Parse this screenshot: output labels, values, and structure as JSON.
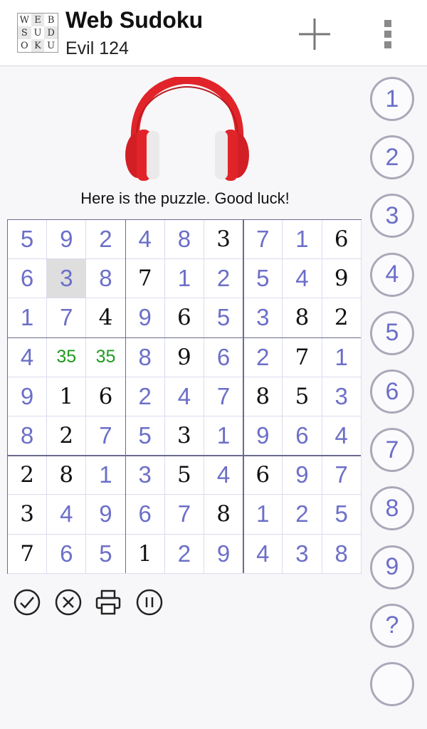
{
  "header": {
    "logo_letters": [
      "W",
      "E",
      "B",
      "S",
      "U",
      "D",
      "O",
      "K",
      "U"
    ],
    "title": "Web Sudoku",
    "subtitle": "Evil 124",
    "new_icon": "plus-icon",
    "menu_icon": "overflow-menu-icon"
  },
  "message": "Here is the puzzle. Good luck!",
  "colors": {
    "given": "#111111",
    "filled": "#6c6fc8",
    "notes": "#1f9a1f",
    "selected_bg": "#dedede",
    "headphones_red": "#e0242a"
  },
  "grid": {
    "rows": [
      [
        {
          "v": "5",
          "t": "filled"
        },
        {
          "v": "9",
          "t": "filled"
        },
        {
          "v": "2",
          "t": "filled"
        },
        {
          "v": "4",
          "t": "filled"
        },
        {
          "v": "8",
          "t": "filled"
        },
        {
          "v": "3",
          "t": "given"
        },
        {
          "v": "7",
          "t": "filled"
        },
        {
          "v": "1",
          "t": "filled"
        },
        {
          "v": "6",
          "t": "given"
        }
      ],
      [
        {
          "v": "6",
          "t": "filled"
        },
        {
          "v": "3",
          "t": "filled",
          "selected": true
        },
        {
          "v": "8",
          "t": "filled"
        },
        {
          "v": "7",
          "t": "given"
        },
        {
          "v": "1",
          "t": "filled"
        },
        {
          "v": "2",
          "t": "filled"
        },
        {
          "v": "5",
          "t": "filled"
        },
        {
          "v": "4",
          "t": "filled"
        },
        {
          "v": "9",
          "t": "given"
        }
      ],
      [
        {
          "v": "1",
          "t": "filled"
        },
        {
          "v": "7",
          "t": "filled"
        },
        {
          "v": "4",
          "t": "given"
        },
        {
          "v": "9",
          "t": "filled"
        },
        {
          "v": "6",
          "t": "given"
        },
        {
          "v": "5",
          "t": "filled"
        },
        {
          "v": "3",
          "t": "filled"
        },
        {
          "v": "8",
          "t": "given"
        },
        {
          "v": "2",
          "t": "given"
        }
      ],
      [
        {
          "v": "4",
          "t": "filled"
        },
        {
          "v": "35",
          "t": "notes"
        },
        {
          "v": "35",
          "t": "notes"
        },
        {
          "v": "8",
          "t": "filled"
        },
        {
          "v": "9",
          "t": "given"
        },
        {
          "v": "6",
          "t": "filled"
        },
        {
          "v": "2",
          "t": "filled"
        },
        {
          "v": "7",
          "t": "given"
        },
        {
          "v": "1",
          "t": "filled"
        }
      ],
      [
        {
          "v": "9",
          "t": "filled"
        },
        {
          "v": "1",
          "t": "given"
        },
        {
          "v": "6",
          "t": "given"
        },
        {
          "v": "2",
          "t": "filled"
        },
        {
          "v": "4",
          "t": "filled"
        },
        {
          "v": "7",
          "t": "filled"
        },
        {
          "v": "8",
          "t": "given"
        },
        {
          "v": "5",
          "t": "given"
        },
        {
          "v": "3",
          "t": "filled"
        }
      ],
      [
        {
          "v": "8",
          "t": "filled"
        },
        {
          "v": "2",
          "t": "given"
        },
        {
          "v": "7",
          "t": "filled"
        },
        {
          "v": "5",
          "t": "filled"
        },
        {
          "v": "3",
          "t": "given"
        },
        {
          "v": "1",
          "t": "filled"
        },
        {
          "v": "9",
          "t": "filled"
        },
        {
          "v": "6",
          "t": "filled"
        },
        {
          "v": "4",
          "t": "filled"
        }
      ],
      [
        {
          "v": "2",
          "t": "given"
        },
        {
          "v": "8",
          "t": "given"
        },
        {
          "v": "1",
          "t": "filled"
        },
        {
          "v": "3",
          "t": "filled"
        },
        {
          "v": "5",
          "t": "given"
        },
        {
          "v": "4",
          "t": "filled"
        },
        {
          "v": "6",
          "t": "given"
        },
        {
          "v": "9",
          "t": "filled"
        },
        {
          "v": "7",
          "t": "filled"
        }
      ],
      [
        {
          "v": "3",
          "t": "given"
        },
        {
          "v": "4",
          "t": "filled"
        },
        {
          "v": "9",
          "t": "filled"
        },
        {
          "v": "6",
          "t": "filled"
        },
        {
          "v": "7",
          "t": "filled"
        },
        {
          "v": "8",
          "t": "given"
        },
        {
          "v": "1",
          "t": "filled"
        },
        {
          "v": "2",
          "t": "filled"
        },
        {
          "v": "5",
          "t": "filled"
        }
      ],
      [
        {
          "v": "7",
          "t": "given"
        },
        {
          "v": "6",
          "t": "filled"
        },
        {
          "v": "5",
          "t": "filled"
        },
        {
          "v": "1",
          "t": "given"
        },
        {
          "v": "2",
          "t": "filled"
        },
        {
          "v": "9",
          "t": "filled"
        },
        {
          "v": "4",
          "t": "filled"
        },
        {
          "v": "3",
          "t": "filled"
        },
        {
          "v": "8",
          "t": "filled"
        }
      ]
    ]
  },
  "toolbar": [
    {
      "name": "check-button",
      "icon": "check-circle-icon"
    },
    {
      "name": "clear-button",
      "icon": "x-circle-icon"
    },
    {
      "name": "print-button",
      "icon": "printer-icon"
    },
    {
      "name": "pause-button",
      "icon": "pause-circle-icon"
    }
  ],
  "numpad": [
    "1",
    "2",
    "3",
    "4",
    "5",
    "6",
    "7",
    "8",
    "9",
    "?",
    ""
  ]
}
